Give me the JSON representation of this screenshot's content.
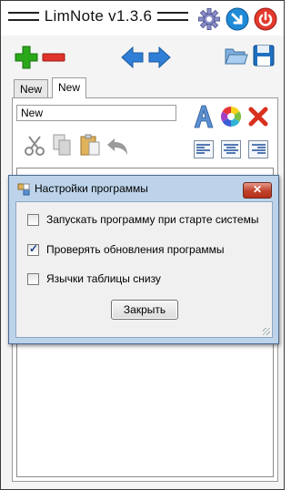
{
  "app": {
    "title": "LimNote v1.3.6"
  },
  "titlebar": {
    "icons": [
      "gear-icon",
      "minimize-icon",
      "power-icon"
    ]
  },
  "toolbar": {
    "icons": [
      "add-icon",
      "remove-icon",
      "back-arrow-icon",
      "forward-arrow-icon",
      "open-folder-icon",
      "save-icon"
    ]
  },
  "tabs": [
    {
      "label": "New"
    },
    {
      "label": "New"
    }
  ],
  "note": {
    "name_value": "New",
    "format_icons": [
      "font-icon",
      "color-wheel-icon",
      "delete-icon"
    ],
    "edit_icons": [
      "cut-icon",
      "copy-icon",
      "paste-icon",
      "undo-icon"
    ],
    "align_icons": [
      "align-left-icon",
      "align-center-icon",
      "align-right-icon"
    ]
  },
  "dialog": {
    "title": "Настройки программы",
    "close_glyph": "✕",
    "options": [
      {
        "label": "Запускать программу при старте системы",
        "checked": false
      },
      {
        "label": "Проверять обновления программы",
        "checked": true
      },
      {
        "label": "Язычки таблицы снизу",
        "checked": false
      }
    ],
    "close_button": "Закрыть"
  },
  "colors": {
    "add": "#2aa81a",
    "remove": "#e0332b",
    "arrows": "#2f7fd6",
    "dialog_frame": "#bcd3ea"
  }
}
